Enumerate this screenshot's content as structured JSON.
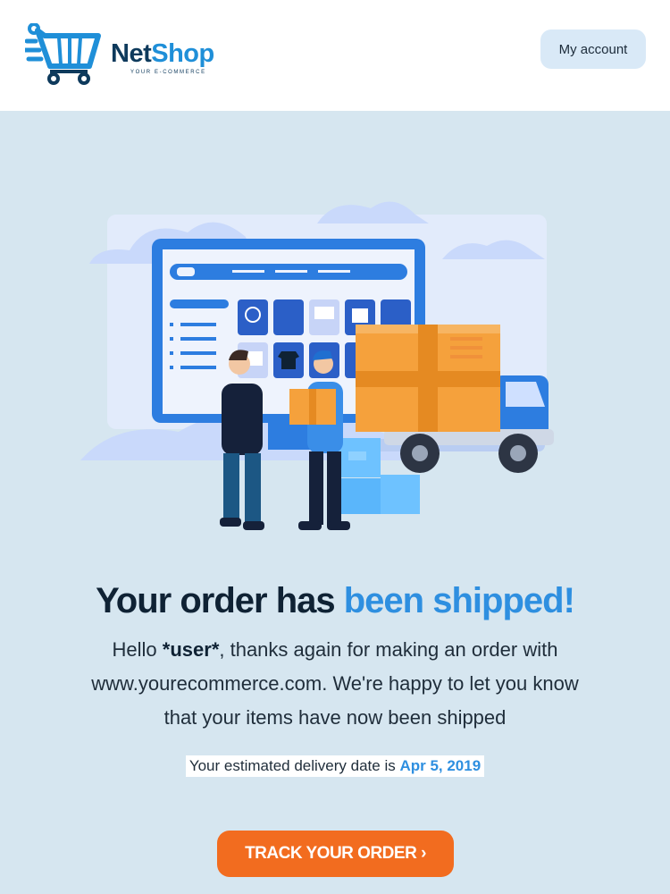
{
  "brand": {
    "name_part1": "Net",
    "name_part2": "Shop",
    "tagline": "YOUR E-COMMERCE"
  },
  "header": {
    "account_label": "My account"
  },
  "headline": {
    "part1": "Your order has ",
    "part2": "been shipped!"
  },
  "message": {
    "greeting": "Hello ",
    "user": "*user*",
    "line1_rest": ", thanks again for making an order with",
    "line2": "www.yourecommerce.com. We're happy to let you know",
    "line3": "that your items have now been shipped"
  },
  "delivery": {
    "label": "Your estimated delivery date is ",
    "date": "Apr 5, 2019"
  },
  "cta": {
    "label": "TRACK YOUR ORDER ›"
  },
  "colors": {
    "brand_dark": "#0e3a5c",
    "brand_blue": "#1f8fd8",
    "accent_blue": "#2e8fe0",
    "cta_orange": "#f26c1f",
    "page_bg": "#d6e6f0"
  },
  "icons": [
    "shopping-cart-icon",
    "monitor-icon",
    "delivery-truck-icon",
    "package-box-icon",
    "clock-icon",
    "shirt-icon",
    "gift-icon"
  ]
}
